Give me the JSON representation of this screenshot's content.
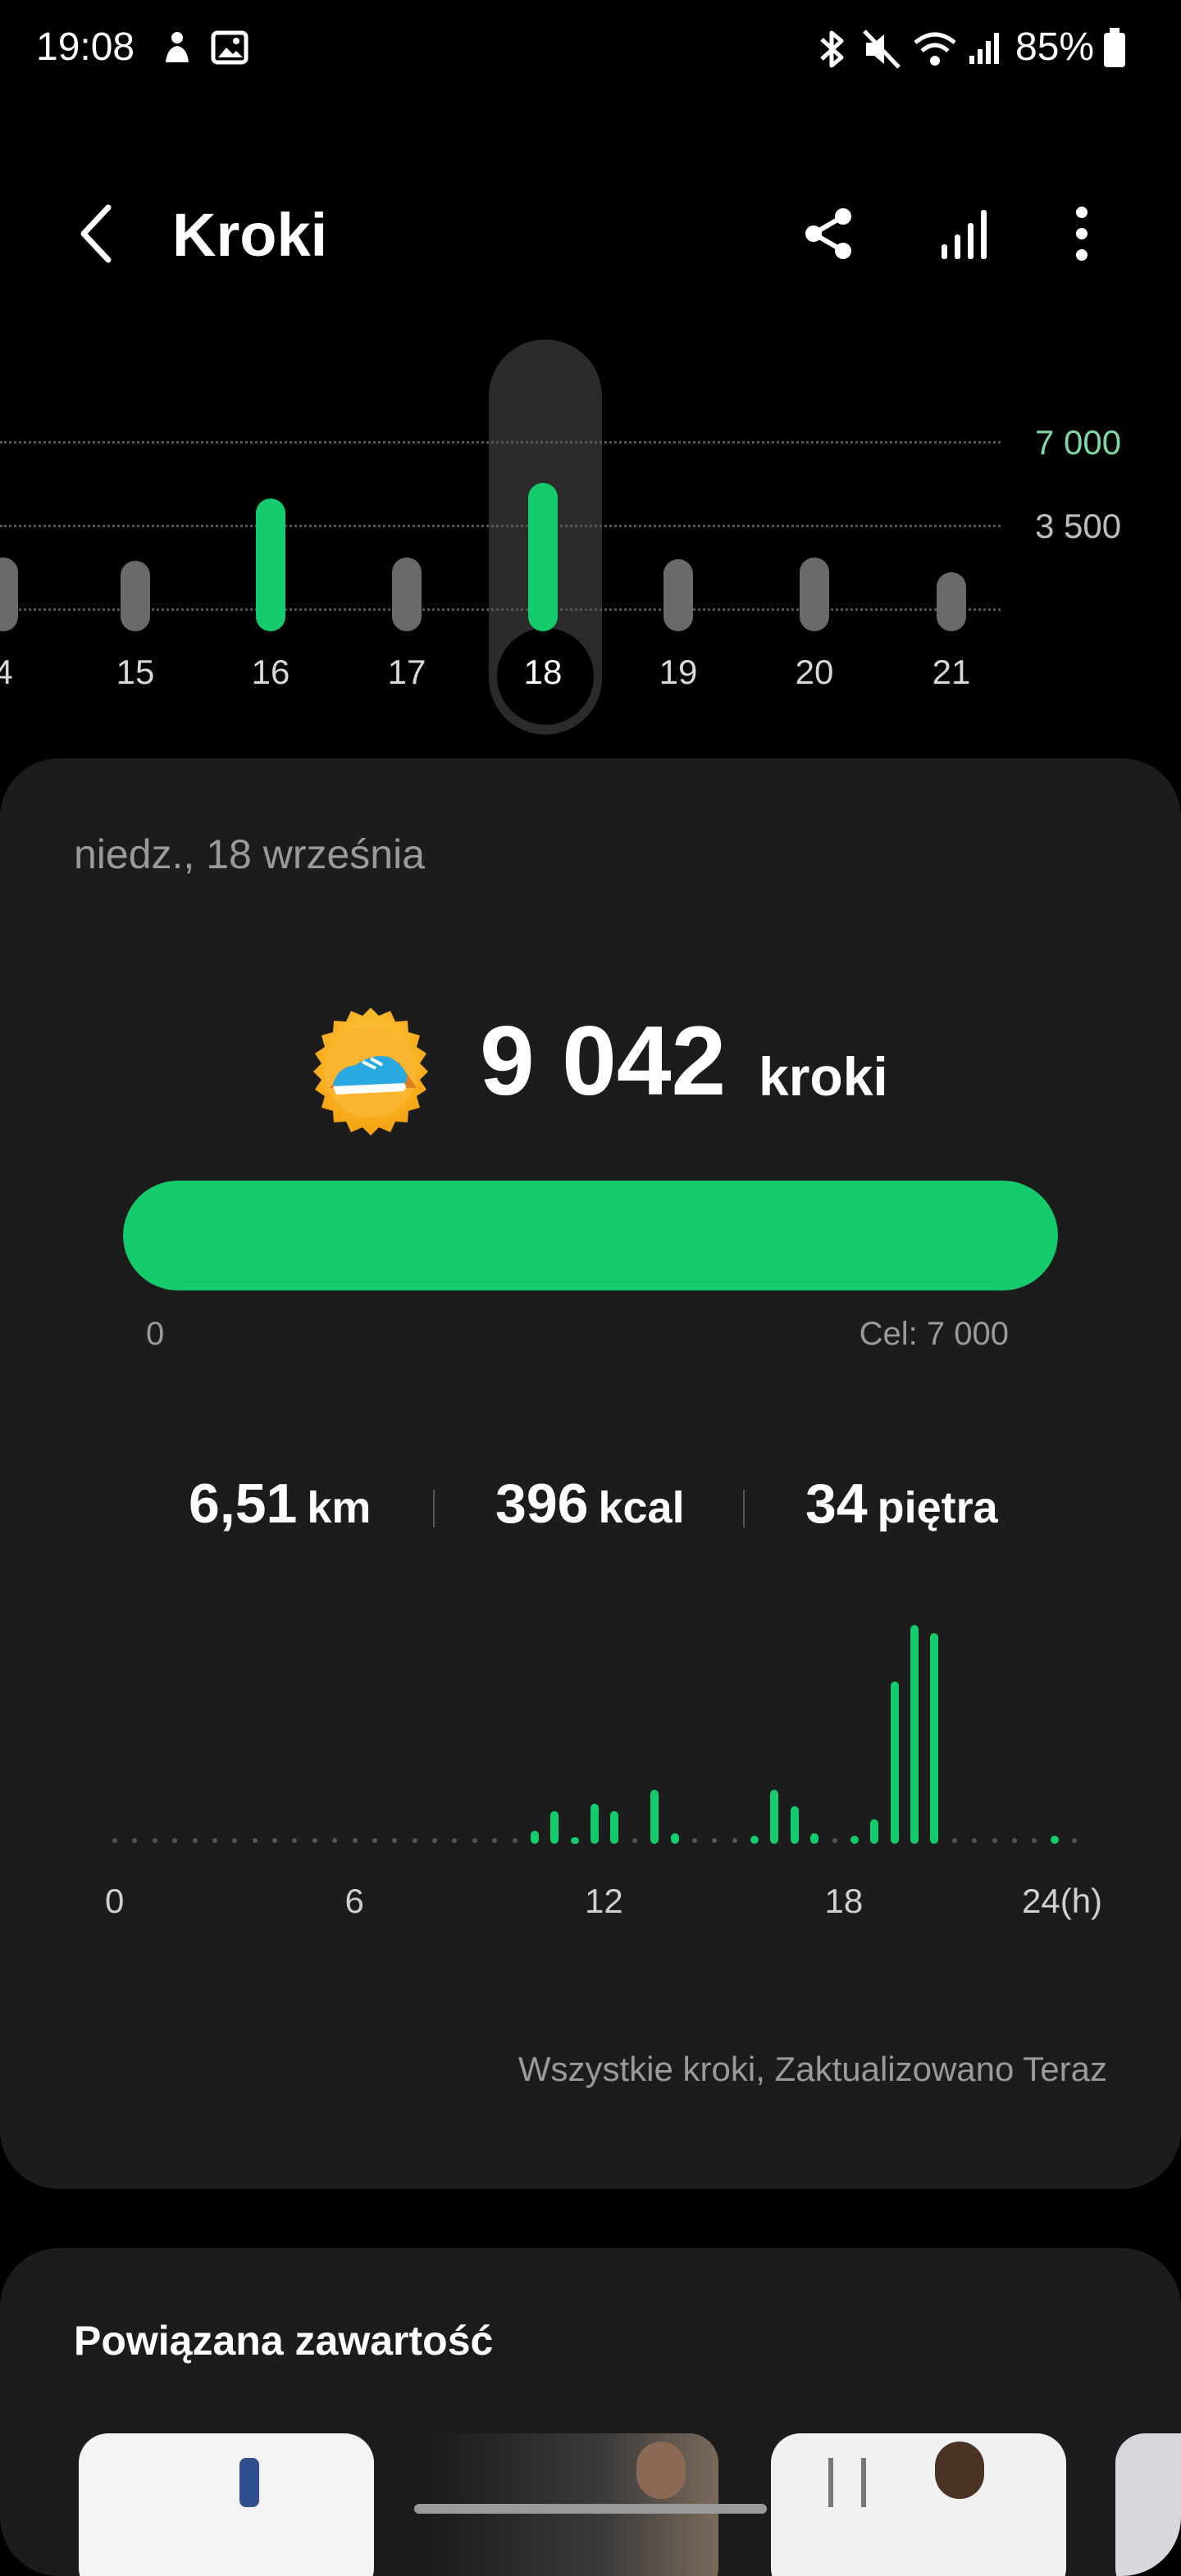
{
  "status_bar": {
    "time": "19:08",
    "battery": "85%",
    "icons": [
      "notification-icon",
      "gallery-icon",
      "bluetooth-icon",
      "mute-icon",
      "wifi-icon",
      "signal-icon",
      "battery-icon"
    ]
  },
  "header": {
    "title": "Kroki",
    "back_icon": "back-arrow-icon",
    "actions": [
      "share-icon",
      "chart-icon",
      "more-options-icon"
    ]
  },
  "day_selector": {
    "gridlines": [
      {
        "label": "7 000",
        "color": "#7fd6a0"
      },
      {
        "label": "3 500",
        "color": "#bdbdbd"
      }
    ],
    "days": [
      {
        "label": "4",
        "steps": 4500,
        "goal_met": false
      },
      {
        "label": "15",
        "steps": 4300,
        "goal_met": false
      },
      {
        "label": "16",
        "steps": 8100,
        "goal_met": true
      },
      {
        "label": "17",
        "steps": 4500,
        "goal_met": false
      },
      {
        "label": "18",
        "steps": 9042,
        "goal_met": true,
        "selected": true
      },
      {
        "label": "19",
        "steps": 4400,
        "goal_met": false
      },
      {
        "label": "20",
        "steps": 4500,
        "goal_met": false
      },
      {
        "label": "21",
        "steps": 3600,
        "goal_met": false
      }
    ],
    "scale_max": 10000
  },
  "summary": {
    "date": "niedz., 18 września",
    "steps": "9 042",
    "steps_unit": "kroki",
    "badge_icon": "shoe-badge-icon",
    "progress_fraction": 1.0,
    "progress_min": "0",
    "progress_goal": "Cel: 7 000"
  },
  "stats": [
    {
      "value": "6,51",
      "unit": "km"
    },
    {
      "value": "396",
      "unit": "kcal"
    },
    {
      "value": "34",
      "unit": "piętra"
    }
  ],
  "hourly": {
    "x_labels": [
      "0",
      "6",
      "12",
      "18",
      "24(h)"
    ],
    "bars": [
      {
        "hour": 10.5,
        "steps": 50
      },
      {
        "hour": 11.0,
        "steps": 120
      },
      {
        "hour": 11.5,
        "steps": 25
      },
      {
        "hour": 12.0,
        "steps": 150
      },
      {
        "hour": 12.5,
        "steps": 120
      },
      {
        "hour": 13.5,
        "steps": 200
      },
      {
        "hour": 14.0,
        "steps": 40
      },
      {
        "hour": 16.0,
        "steps": 30
      },
      {
        "hour": 16.5,
        "steps": 200
      },
      {
        "hour": 17.0,
        "steps": 140
      },
      {
        "hour": 17.5,
        "steps": 40
      },
      {
        "hour": 18.5,
        "steps": 30
      },
      {
        "hour": 19.0,
        "steps": 90
      },
      {
        "hour": 19.5,
        "steps": 600
      },
      {
        "hour": 20.0,
        "steps": 810
      },
      {
        "hour": 20.5,
        "steps": 780
      },
      {
        "hour": 23.5,
        "steps": 30
      }
    ],
    "max_steps": 820,
    "update_text": "Wszystkie kroki, Zaktualizowano Teraz"
  },
  "related": {
    "title": "Powiązana zawartość"
  }
}
